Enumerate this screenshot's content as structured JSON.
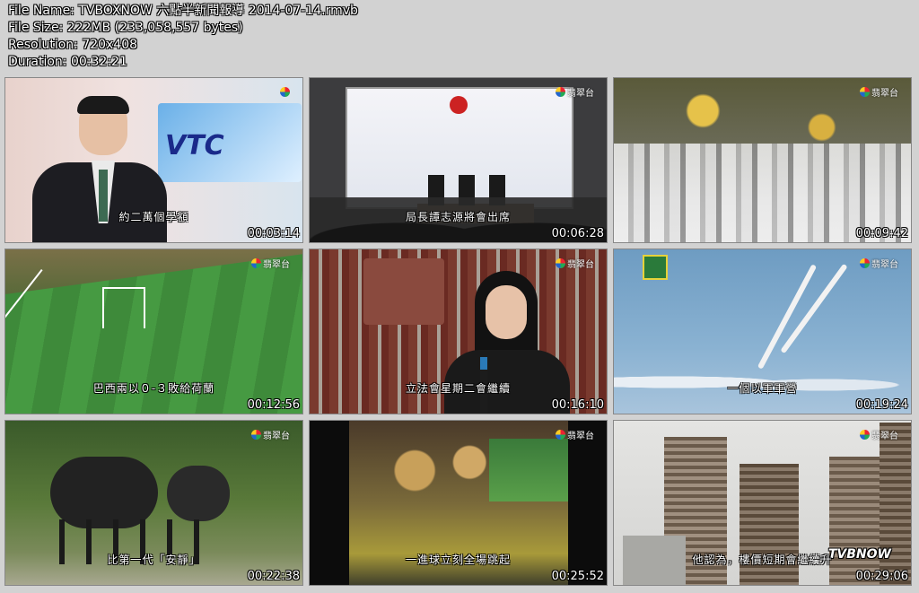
{
  "file_info": {
    "name_label": "File Name: ",
    "name": "TVBOXNOW 六點半新聞報導 2014-07-14.rmvb",
    "size_label": "File Size: ",
    "size": "222MB (233,058,557 bytes)",
    "resolution_label": "Resolution: ",
    "resolution": "720x408",
    "duration_label": "Duration: ",
    "duration": "00:32:21"
  },
  "channel_logo": "翡翠台",
  "thumbnails": [
    {
      "timestamp": "00:03:14",
      "subtitle": "約二萬個學額",
      "overlay": "VTC"
    },
    {
      "timestamp": "00:06:28",
      "subtitle": "局長譚志源將會出席",
      "overlay": ""
    },
    {
      "timestamp": "00:09:42",
      "subtitle": "",
      "overlay": ""
    },
    {
      "timestamp": "00:12:56",
      "subtitle": "巴西兩以０-３敗給荷蘭",
      "overlay": ""
    },
    {
      "timestamp": "00:16:10",
      "subtitle": "立法會星期二會繼續",
      "overlay": ""
    },
    {
      "timestamp": "00:19:24",
      "subtitle": "一個以軍軍營",
      "overlay": ""
    },
    {
      "timestamp": "00:22:38",
      "subtitle": "比第一代「安靜」",
      "overlay": ""
    },
    {
      "timestamp": "00:25:52",
      "subtitle": "一進球立刻全場跳起",
      "overlay": ""
    },
    {
      "timestamp": "00:29:06",
      "subtitle": "他認為，樓價短期會繼續升",
      "overlay": "TVBNOW"
    }
  ]
}
